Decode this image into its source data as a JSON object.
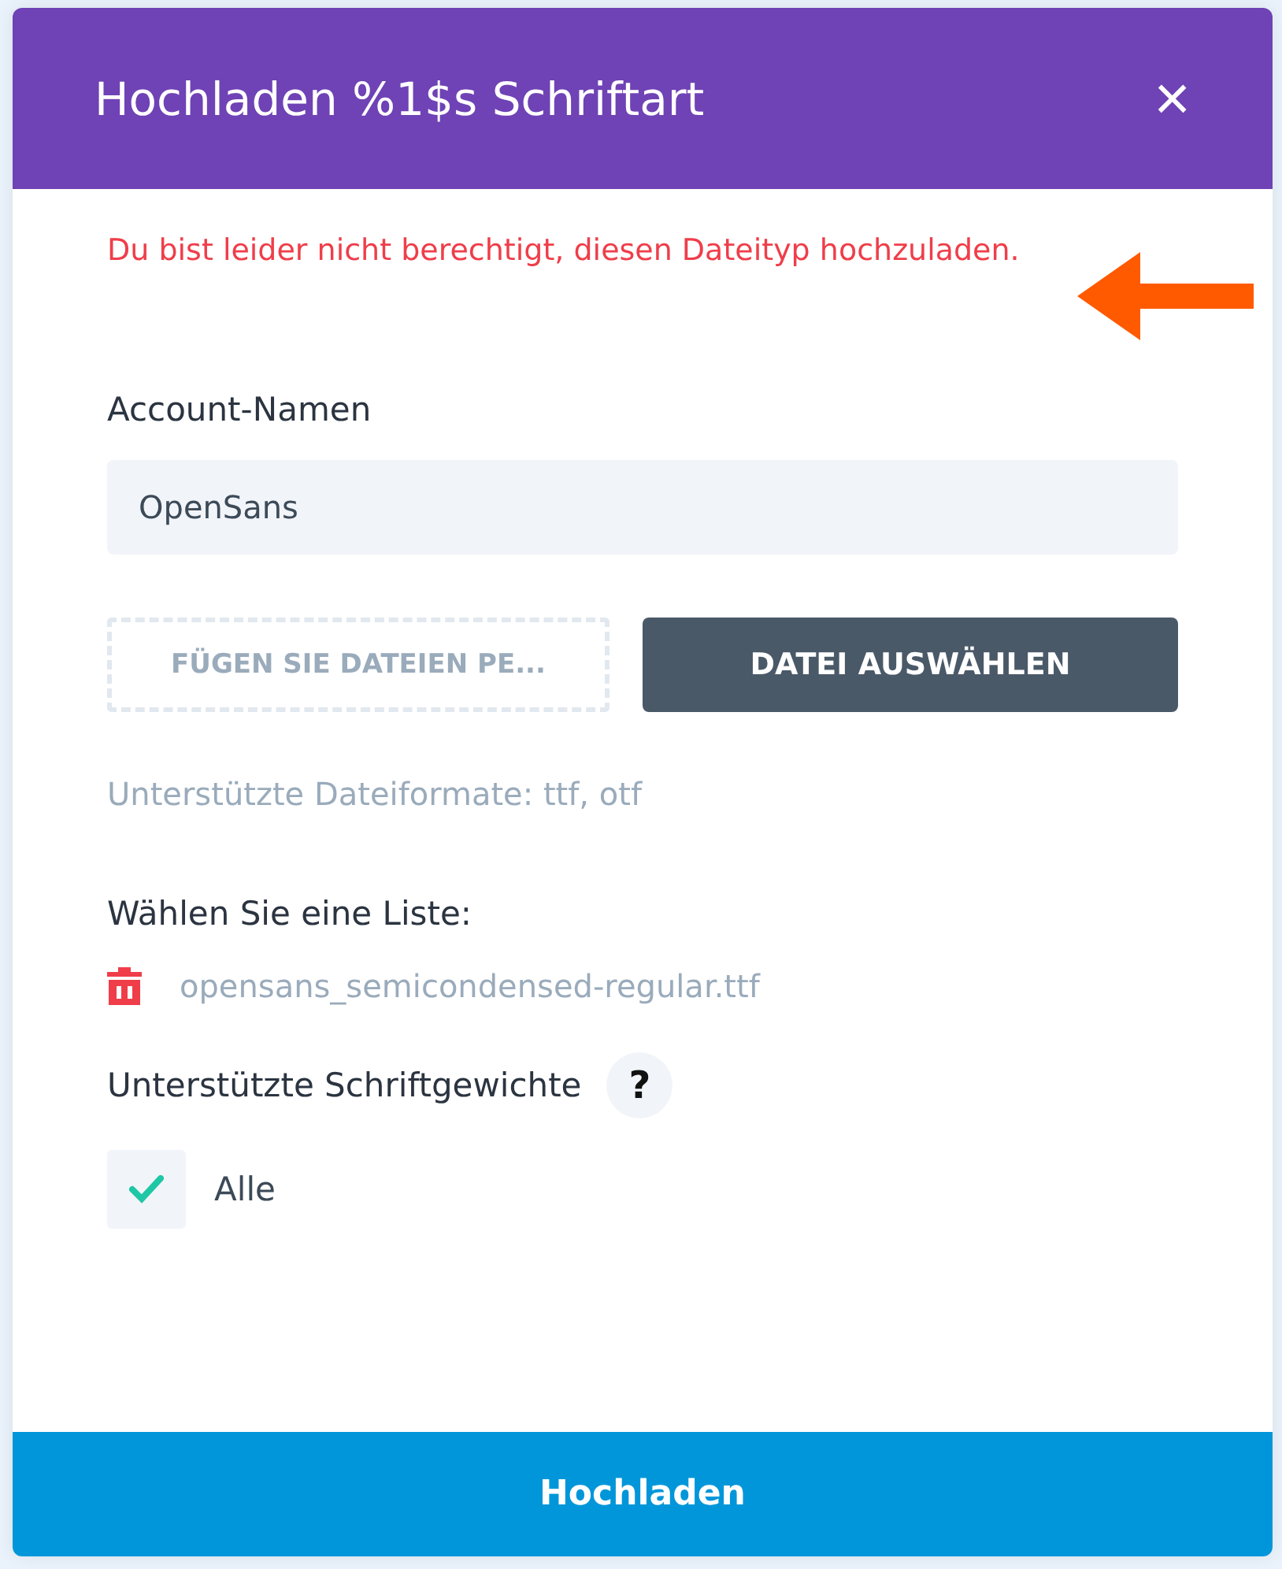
{
  "dialog": {
    "title": "Hochladen %1$s Schriftart",
    "close": "×"
  },
  "error": "Du bist leider nicht berechtigt, diesen Dateityp hochzuladen.",
  "name_field": {
    "label": "Account-Namen",
    "value": "OpenSans"
  },
  "dropzone": "FÜGEN SIE DATEIEN PE...",
  "choose_button": "DATEI AUSWÄHLEN",
  "formats_hint": "Unterstützte Dateiformate: ttf, otf",
  "list_label": "Wählen Sie eine Liste:",
  "files": [
    "opensans_semicondensed-regular.ttf"
  ],
  "weights": {
    "label": "Unterstützte Schriftgewichte",
    "help": "?",
    "options": [
      {
        "label": "Alle",
        "checked": true
      }
    ]
  },
  "submit": "Hochladen"
}
